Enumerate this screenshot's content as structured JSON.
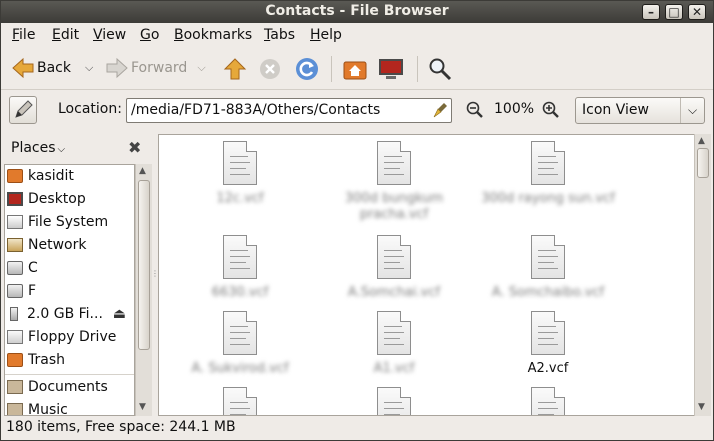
{
  "window": {
    "title": "Contacts - File Browser",
    "controls": {
      "minimize": "–",
      "maximize": "□",
      "close": "✕"
    }
  },
  "menu": [
    {
      "accel": "F",
      "rest": "ile"
    },
    {
      "accel": "E",
      "rest": "dit"
    },
    {
      "accel": "V",
      "rest": "iew"
    },
    {
      "accel": "G",
      "rest": "o"
    },
    {
      "accel": "B",
      "rest": "ookmarks"
    },
    {
      "accel": "T",
      "rest": "abs"
    },
    {
      "accel": "H",
      "rest": "elp"
    }
  ],
  "toolbar": {
    "back_label": "Back",
    "forward_label": "Forward"
  },
  "location": {
    "label": "Location:",
    "path": "/media/FD71-883A/Others/Contacts",
    "zoom": "100%",
    "view": "Icon View"
  },
  "sidebar": {
    "header": "Places",
    "items": [
      {
        "label": "kasidit",
        "icon": "home-folder-icon"
      },
      {
        "label": "Desktop",
        "icon": "desktop-icon"
      },
      {
        "label": "File System",
        "icon": "filesystem-icon"
      },
      {
        "label": "Network",
        "icon": "network-icon"
      },
      {
        "label": "C",
        "icon": "drive-icon"
      },
      {
        "label": "F",
        "icon": "drive-icon"
      },
      {
        "label": "2.0 GB Fi...",
        "icon": "usb-drive-icon"
      },
      {
        "label": "Floppy Drive",
        "icon": "floppy-icon"
      },
      {
        "label": "Trash",
        "icon": "trash-icon"
      },
      {
        "label": "Documents",
        "icon": "folder-icon"
      },
      {
        "label": "Music",
        "icon": "folder-icon"
      }
    ]
  },
  "files": [
    {
      "name": "12c.vcf",
      "blurred": true
    },
    {
      "name": "300d bungkum pracha.vcf",
      "blurred": true
    },
    {
      "name": "300d rayong sun.vcf",
      "blurred": true
    },
    {
      "name": "6630.vcf",
      "blurred": true
    },
    {
      "name": "A.Somchai.vcf",
      "blurred": true
    },
    {
      "name": "A. Somchaibo.vcf",
      "blurred": true
    },
    {
      "name": "A. Sukvirod.vcf",
      "blurred": true
    },
    {
      "name": "A1.vcf",
      "blurred": true
    },
    {
      "name": "A2.vcf",
      "blurred": false
    },
    {
      "name": "",
      "blurred": true
    },
    {
      "name": "",
      "blurred": true
    },
    {
      "name": "",
      "blurred": true
    }
  ],
  "status": {
    "text": "180 items, Free space: 244.1 MB"
  },
  "colors": {
    "titlebar": "#3c3b37",
    "accent": "#e17a2c",
    "window_bg": "#efebe7"
  }
}
